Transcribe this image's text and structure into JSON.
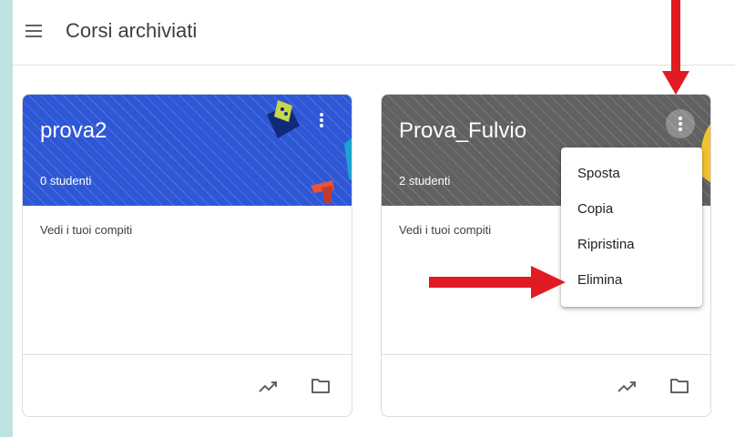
{
  "header": {
    "title": "Corsi archiviati",
    "menu_icon": "hamburger-menu-icon"
  },
  "courses": [
    {
      "title": "prova2",
      "students": "0 studenti",
      "link": "Vedi i tuoi compiti",
      "header_color": "#2e57d6",
      "menu_icon": "more-vert-icon",
      "footer_icons": [
        "trending-up-icon",
        "folder-icon"
      ]
    },
    {
      "title": "Prova_Fulvio",
      "students": "2 studenti",
      "link": "Vedi i tuoi compiti",
      "header_color": "#616161",
      "menu_icon": "more-vert-icon",
      "footer_icons": [
        "trending-up-icon",
        "folder-icon"
      ]
    }
  ],
  "context_menu": {
    "items": [
      "Sposta",
      "Copia",
      "Ripristina",
      "Elimina"
    ]
  },
  "annotations": {
    "arrow_color": "#e11b22"
  }
}
